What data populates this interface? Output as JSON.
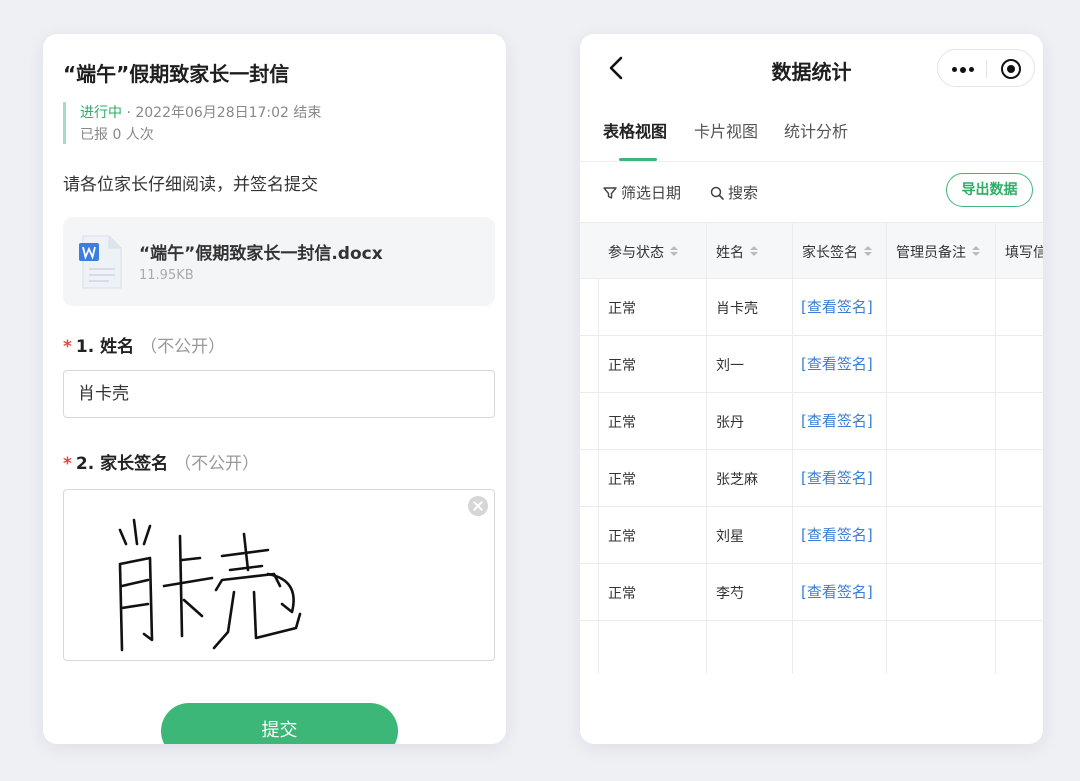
{
  "form": {
    "title": "“端午”假期致家长一封信",
    "status_label": "进行中",
    "status_detail": " · 2022年06月28日17:02 结束",
    "report_count": "已报 0 人次",
    "description": "请各位家长仔细阅读，并签名提交",
    "attachment": {
      "icon": "word-document-icon",
      "name": "“端午”假期致家长一封信.docx",
      "size": "11.95KB"
    },
    "questions": [
      {
        "number": "1. 姓名",
        "visibility": "（不公开）",
        "value": "肖卡壳"
      },
      {
        "number": "2. 家长签名",
        "visibility": "（不公开）"
      }
    ],
    "submit_label": "提交",
    "colors": {
      "accent": "#3db777",
      "required": "#e04a3f"
    }
  },
  "stats": {
    "title": "数据统计",
    "tabs": [
      "表格视图",
      "卡片视图",
      "统计分析"
    ],
    "active_tab": "表格视图",
    "filter_label": "筛选日期",
    "search_label": "搜索",
    "export_label": "导出数据",
    "columns": [
      "参与状态",
      "姓名",
      "家长签名",
      "管理员备注",
      "填写信"
    ],
    "rows": [
      {
        "status": "正常",
        "name": "肖卡壳",
        "signature": "[查看签名]"
      },
      {
        "status": "正常",
        "name": "刘一",
        "signature": "[查看签名]"
      },
      {
        "status": "正常",
        "name": "张丹",
        "signature": "[查看签名]"
      },
      {
        "status": "正常",
        "name": "张芝麻",
        "signature": "[查看签名]"
      },
      {
        "status": "正常",
        "name": "刘星",
        "signature": "[查看签名]"
      },
      {
        "status": "正常",
        "name": "李芍",
        "signature": "[查看签名]"
      }
    ],
    "link_color": "#3a7ed6"
  }
}
